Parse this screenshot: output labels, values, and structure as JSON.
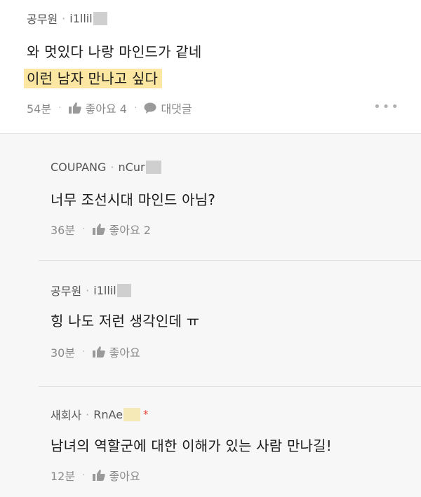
{
  "top_comment": {
    "author_org": "공무원",
    "author_id": "i1llil",
    "line1": "와 멋있다 나랑 마인드가 같네",
    "line2": "이런 남자 만나고 싶다",
    "time": "54분",
    "like_label": "좋아요 4",
    "reply_label": "대댓글",
    "more": "•••"
  },
  "replies": [
    {
      "author_org": "COUPANG",
      "author_id": "nCur",
      "text": "너무 조선시대 마인드 아님?",
      "time": "36분",
      "like_label": "좋아요 2"
    },
    {
      "author_org": "공무원",
      "author_id": "i1llil",
      "text": "힝 나도 저런 생각인데 ㅠ",
      "time": "30분",
      "like_label": "좋아요"
    },
    {
      "author_org": "새회사",
      "author_id": "RnAe",
      "author_marker": "*",
      "text": "남녀의 역할군에 대한 이해가 있는 사람 만나길!",
      "time": "12분",
      "like_label": "좋아요"
    }
  ],
  "separator": "·",
  "icons": {
    "like": "thumbs-up-icon",
    "reply": "speech-bubble-icon",
    "more": "more-dots-icon"
  },
  "colors": {
    "highlight": "#fbe6a2",
    "marker": "#e8463c",
    "mask_gray": "#cfcfcf",
    "mask_yellow": "#f6e9b8"
  }
}
